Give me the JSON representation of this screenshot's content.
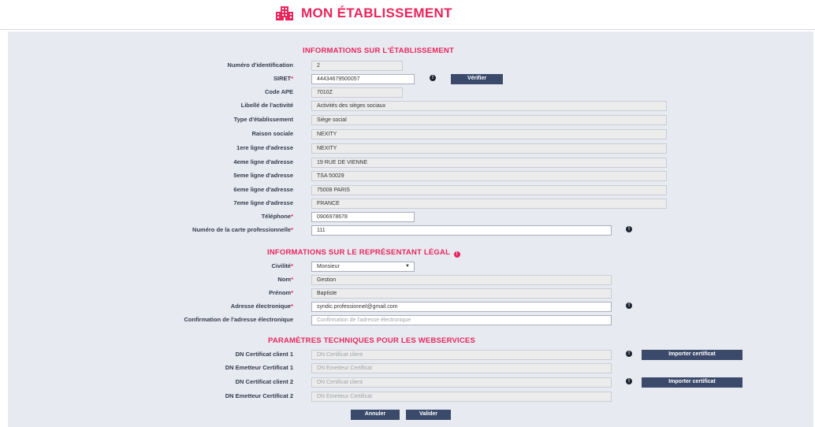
{
  "header": {
    "title": "MON ÉTABLISSEMENT"
  },
  "sections": {
    "etablissement": "INFORMATIONS SUR L'ÉTABLISSEMENT",
    "representant": "INFORMATIONS SUR LE REPRÉSENTANT LÉGAL",
    "parametres": "PARAMÈTRES TECHNIQUES POUR LES WEBSERVICES"
  },
  "etablissement": {
    "numero_label": "Numéro d'identification",
    "numero_value": "2",
    "siret_label": "SIRET",
    "siret_value": "44434679500057",
    "verifier_label": "Vérifier",
    "ape_label": "Code APE",
    "ape_value": "7010Z",
    "libelle_label": "Libellé de l'activité",
    "libelle_value": "Activités des sièges sociaux",
    "type_label": "Type d'établissement",
    "type_value": "Siège social",
    "raison_label": "Raison sociale",
    "raison_value": "NEXITY",
    "adr1_label": "1ere ligne d'adresse",
    "adr1_value": "NEXITY",
    "adr4_label": "4eme ligne d'adresse",
    "adr4_value": "19 RUE DE VIENNE",
    "adr5_label": "5eme ligne d'adresse",
    "adr5_value": "TSA 50029",
    "adr6_label": "6eme ligne d'adresse",
    "adr6_value": "75008 PARIS",
    "adr7_label": "7eme ligne d'adresse",
    "adr7_value": "FRANCE",
    "tel_label": "Téléphone",
    "tel_value": "0906978678",
    "carte_label": "Numéro de la carte professionnelle",
    "carte_value": "111"
  },
  "representant": {
    "civilite_label": "Civilité",
    "civilite_value": "Monsieur",
    "nom_label": "Nom",
    "nom_value": "Gestion",
    "prenom_label": "Prénom",
    "prenom_value": "Baptiste",
    "email_label": "Adresse électronique",
    "email_value": "syndic.professionnel@gmail.com",
    "confirm_label": "Confirmation de l'adresse électronique",
    "confirm_placeholder": "Confirmation de l'adresse électronique"
  },
  "parametres": {
    "dn1_label": "DN Certificat client 1",
    "dn1_placeholder": "DN Certificat client",
    "em1_label": "DN Emetteur Certificat 1",
    "em1_placeholder": "DN Emetteur Certificat",
    "dn2_label": "DN Certificat client 2",
    "dn2_placeholder": "DN Certificat client",
    "em2_label": "DN Emetteur Certificat 2",
    "em2_placeholder": "DN Emetteur Certificat",
    "import_label": "Importer certificat"
  },
  "actions": {
    "annuler": "Annuler",
    "valider": "Valider"
  },
  "required_mark": "*",
  "info_glyph": "!",
  "select_caret": "▼",
  "colors": {
    "accent": "#e8265c",
    "button": "#3b4a6b",
    "panel": "#e8eaf1"
  }
}
